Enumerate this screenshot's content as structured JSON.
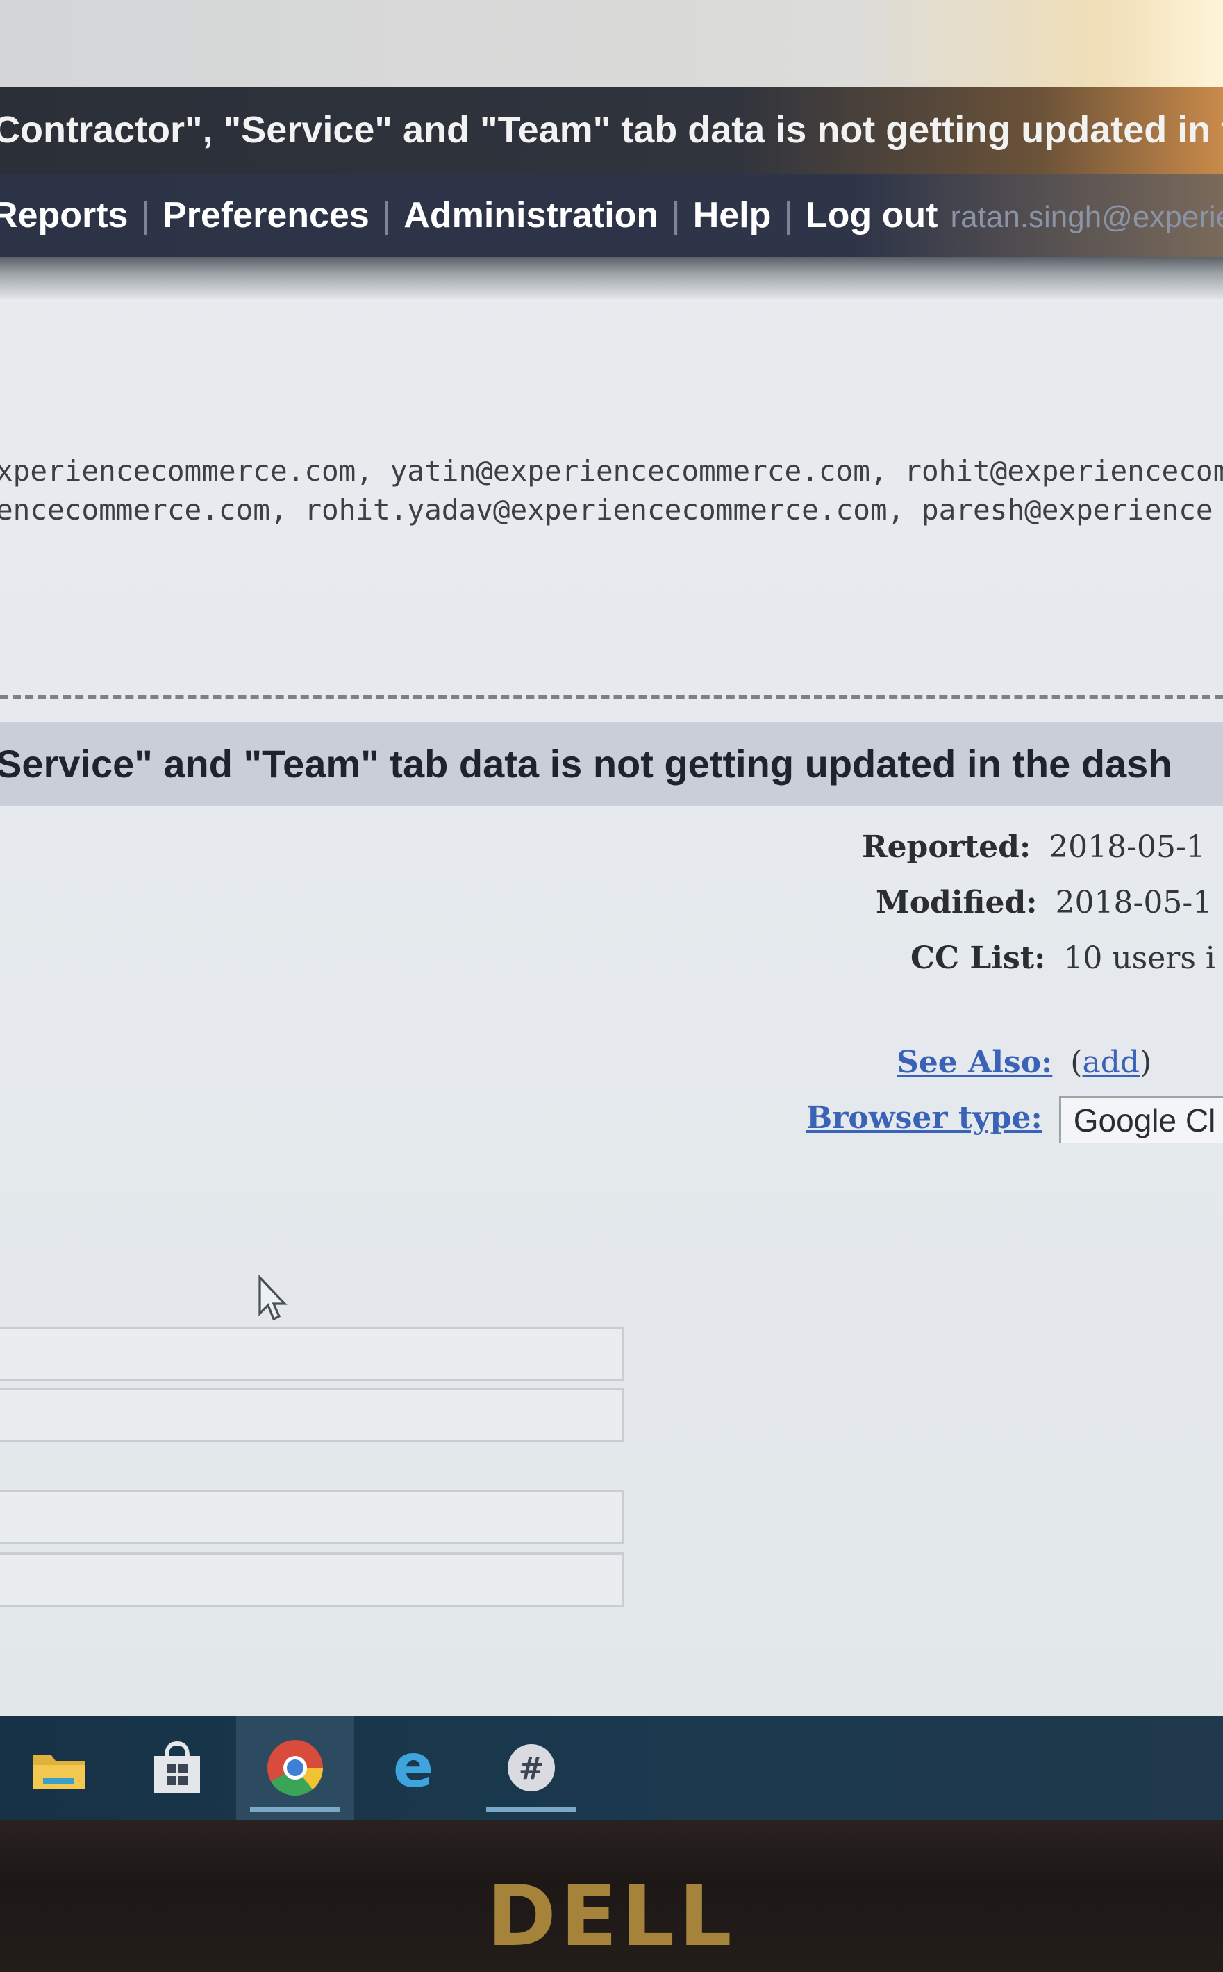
{
  "header": {
    "title_text": "Contractor\", \"Service\" and \"Team\" tab data is not getting updated in the da"
  },
  "nav": {
    "items": [
      "Reports",
      "Preferences",
      "Administration",
      "Help",
      "Log out"
    ],
    "user": "ratan.singh@experiencecomme"
  },
  "cc_list_lines": [
    "xperiencecommerce.com, yatin@experiencecommerce.com, rohit@experiencecom",
    "encecommerce.com, rohit.yadav@experiencecommerce.com, paresh@experience"
  ],
  "summary": "Service\" and \"Team\" tab data is not getting updated in the dash",
  "fields": {
    "reported": {
      "label": "Reported:",
      "value": "2018-05-1"
    },
    "modified": {
      "label": "Modified:",
      "value": "2018-05-1"
    },
    "cc_list": {
      "label": "CC List:",
      "value": "10 users i"
    },
    "see_also": {
      "label": "See Also:",
      "open": "(",
      "add": "add",
      "close": ")"
    },
    "browser_type": {
      "label": "Browser type:",
      "value": "Google Cl"
    }
  },
  "taskbar": {
    "icons": [
      "file-explorer-icon",
      "store-icon",
      "chrome-icon",
      "edge-icon",
      "slack-icon"
    ],
    "active": "chrome-icon"
  },
  "bezel": {
    "logo_text": "DELL"
  },
  "colors": {
    "header_bg": "#2b2f38",
    "nav_bg": "#2c3346",
    "summary_bg": "#c9ced9",
    "link": "#3a63b8",
    "taskbar_bg": "#173246",
    "logo": "#a5833a"
  }
}
